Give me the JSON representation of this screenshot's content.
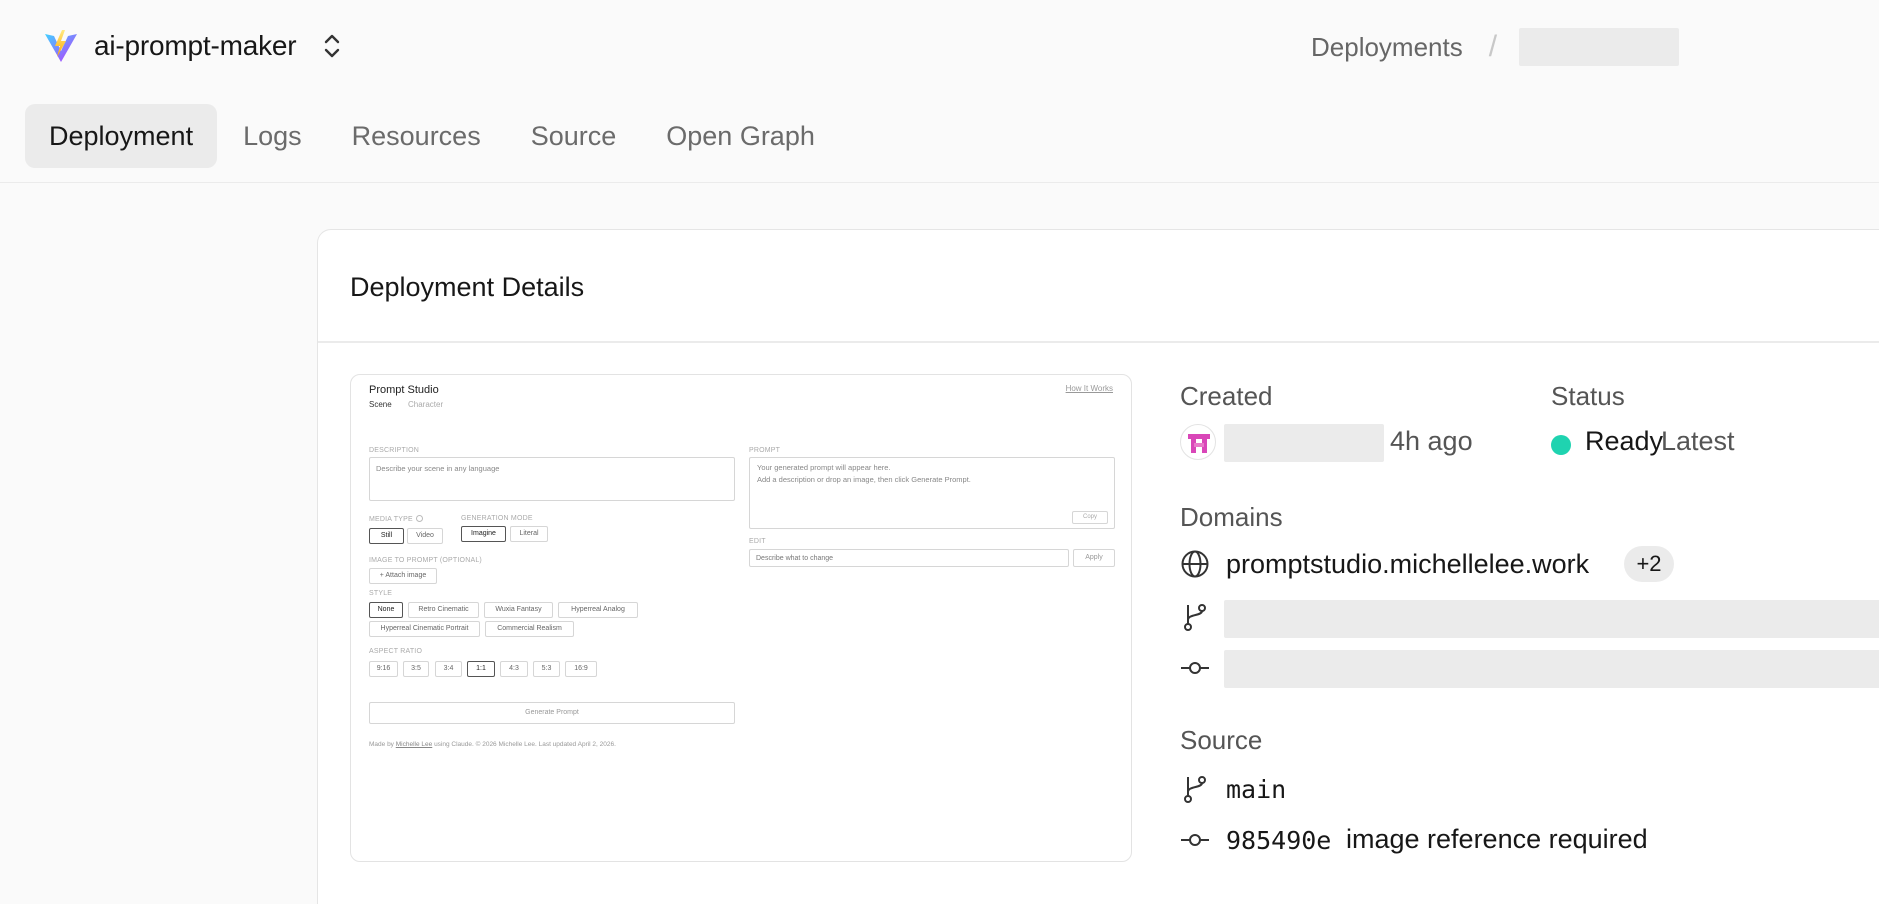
{
  "project": {
    "name": "ai-prompt-maker",
    "logo_icon": "vite-logo-icon",
    "switcher_icon": "chevron-up-down-icon"
  },
  "breadcrumb": {
    "items": [
      "Deployments"
    ],
    "separator": "/"
  },
  "tabs": [
    {
      "label": "Deployment",
      "active": true
    },
    {
      "label": "Logs",
      "active": false
    },
    {
      "label": "Resources",
      "active": false
    },
    {
      "label": "Source",
      "active": false
    },
    {
      "label": "Open Graph",
      "active": false
    }
  ],
  "details": {
    "title": "Deployment Details",
    "created": {
      "label": "Created",
      "ago": "4h ago"
    },
    "status": {
      "label": "Status",
      "value": "Ready",
      "tag": "Latest",
      "color": "#1fd3b0"
    },
    "domains": {
      "label": "Domains",
      "primary": "promptstudio.michellelee.work",
      "extra_count": "+2"
    },
    "source": {
      "label": "Source",
      "branch": "main",
      "commit_sha": "985490e",
      "commit_message": "image reference required"
    }
  },
  "preview": {
    "app_title": "Prompt Studio",
    "how_link": "How It Works",
    "tabs": [
      "Scene",
      "Character"
    ],
    "description_label": "DESCRIPTION",
    "description_placeholder": "Describe your scene in any language",
    "media_type_label": "MEDIA TYPE",
    "media_types": [
      "Still",
      "Video"
    ],
    "generation_mode_label": "GENERATION MODE",
    "generation_modes": [
      "Imagine",
      "Literal"
    ],
    "image_prompt_label": "IMAGE TO PROMPT (OPTIONAL)",
    "attach_label": "+ Attach image",
    "style_label": "STYLE",
    "styles_row1": [
      "None",
      "Retro Cinematic",
      "Wuxia Fantasy",
      "Hyperreal Analog"
    ],
    "styles_row2": [
      "Hyperreal Cinematic Portrait",
      "Commercial Realism"
    ],
    "aspect_label": "ASPECT RATIO",
    "aspect_ratios": [
      "9:16",
      "3:5",
      "3:4",
      "1:1",
      "4:3",
      "5:3",
      "16:9"
    ],
    "generate_label": "Generate Prompt",
    "prompt_label": "PROMPT",
    "prompt_placeholder_1": "Your generated prompt will appear here.",
    "prompt_placeholder_2": "Add a description or drop an image, then click Generate Prompt.",
    "copy_label": "Copy",
    "edit_label": "EDIT",
    "edit_placeholder": "Describe what to change",
    "apply_label": "Apply",
    "footer_made_by": "Made by",
    "footer_author": "Michelle Lee",
    "footer_rest": "using Claude.  © 2026 Michelle Lee. Last updated April 2, 2026."
  }
}
